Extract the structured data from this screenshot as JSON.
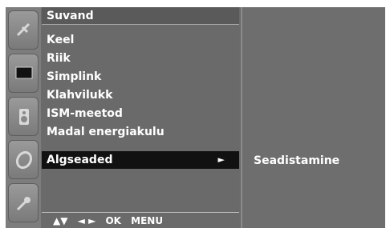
{
  "menu": {
    "title": "Suvand",
    "items": [
      {
        "label": "Keel"
      },
      {
        "label": "Riik"
      },
      {
        "label": "Simplink"
      },
      {
        "label": "Klahvilukk"
      },
      {
        "label": "ISM-meetod"
      },
      {
        "label": "Madal energiakulu"
      },
      {
        "label": "Algseaded",
        "arrow": "►"
      }
    ],
    "selected_index": 6
  },
  "submenu": {
    "items": [
      {
        "label": "Seadistamine"
      }
    ]
  },
  "footer": {
    "updown": "▲▼",
    "leftright": "◄ ►",
    "ok": "OK",
    "menu": "MENU"
  },
  "sidebar_icons": [
    "satellite-icon",
    "monitor-icon",
    "speaker-icon",
    "clock-icon",
    "wrench-icon"
  ],
  "colors": {
    "panel": "#6a6a6a",
    "selected": "#111111",
    "text": "#ffffff"
  }
}
